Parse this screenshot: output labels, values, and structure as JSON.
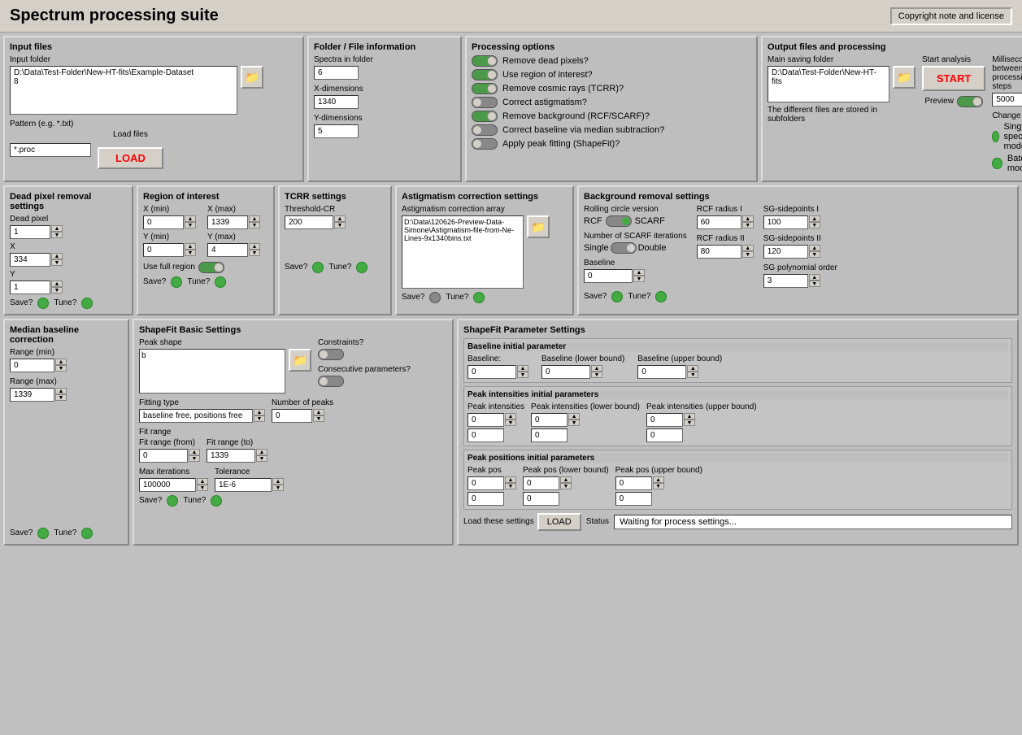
{
  "app": {
    "title": "Spectrum processing suite",
    "copyright_btn": "Copyright note and license"
  },
  "input_files": {
    "section_label": "Input files",
    "input_folder_label": "Input folder",
    "input_folder_value": "D:\\Data\\Test-Folder\\New-HT-fits\\Example-Dataset\n8",
    "pattern_label": "Pattern (e.g. *.txt)",
    "pattern_value": "*.proc",
    "load_files_label": "Load files",
    "load_btn_label": "LOAD"
  },
  "folder_info": {
    "section_label": "Folder / File information",
    "spectra_label": "Spectra in folder",
    "spectra_value": "6",
    "xdim_label": "X-dimensions",
    "xdim_value": "1340",
    "ydim_label": "Y-dimensions",
    "ydim_value": "5"
  },
  "processing_options": {
    "section_label": "Processing options",
    "options": [
      {
        "label": "Remove dead pixels?",
        "state": "on"
      },
      {
        "label": "Use region of interest?",
        "state": "on"
      },
      {
        "label": "Remove cosmic rays (TCRR)?",
        "state": "on"
      },
      {
        "label": "Correct astigmatism?",
        "state": "off"
      },
      {
        "label": "Remove background (RCF/SCARF)?",
        "state": "on"
      },
      {
        "label": "Correct baseline via median subtraction?",
        "state": "off"
      },
      {
        "label": "Apply peak fitting (ShapeFit)?",
        "state": "off"
      }
    ]
  },
  "output_files": {
    "section_label": "Output files and processing",
    "main_saving_folder_label": "Main saving folder",
    "main_saving_folder_value": "D:\\Data\\Test-Folder\\New-HT-fits",
    "subfolders_text": "The different files are stored in subfolders",
    "start_analysis_label": "Start analysis",
    "start_btn_label": "START",
    "preview_label": "Preview",
    "milliseconds_label": "Milliseconds between two processing steps",
    "milliseconds_value": "5000",
    "change_mode_label": "Change mode",
    "single_spectrum_label": "Single spectrum mode",
    "batch_mode_label": "Batch mode"
  },
  "dead_pixel": {
    "section_label": "Dead pixel removal settings",
    "dead_pixel_label": "Dead pixel",
    "dead_pixel_value": "1",
    "x_value": "334",
    "y_value": "1",
    "save_label": "Save?",
    "tune_label": "Tune?"
  },
  "roi": {
    "section_label": "Region of interest",
    "x_min_label": "X (min)",
    "x_min_value": "0",
    "x_max_label": "X (max)",
    "x_max_value": "1339",
    "y_min_label": "Y (min)",
    "y_min_value": "0",
    "y_max_label": "Y (max)",
    "y_max_value": "4",
    "use_full_region_label": "Use full region",
    "save_label": "Save?",
    "tune_label": "Tune?"
  },
  "tcrr": {
    "section_label": "TCRR settings",
    "threshold_label": "Threshold-CR",
    "threshold_value": "200",
    "save_label": "Save?",
    "tune_label": "Tune?"
  },
  "astigmatism": {
    "section_label": "Astigmatism correction settings",
    "array_label": "Astigmatism correction array",
    "array_value": "D:\\Data\\120626-Preview-Data-Simone\\Astigmatism-file-from-Ne-Lines-9x1340bins.txt",
    "save_label": "Save?",
    "tune_label": "Tune?"
  },
  "background": {
    "section_label": "Background removal settings",
    "rolling_circle_label": "Rolling circle version",
    "rcf_label": "RCF",
    "scarf_label": "SCARF",
    "rcf_radius_i_label": "RCF radius I",
    "rcf_radius_i_value": "60",
    "sg_sidepoints_i_label": "SG-sidepoints I",
    "sg_sidepoints_i_value": "100",
    "scarf_iter_label": "Number of SCARF iterations",
    "single_label": "Single",
    "double_label": "Double",
    "rcf_radius_ii_label": "RCF radius II",
    "rcf_radius_ii_value": "80",
    "sg_sidepoints_ii_label": "SG-sidepoints II",
    "sg_sidepoints_ii_value": "120",
    "baseline_label": "Baseline",
    "baseline_value": "0",
    "sg_poly_label": "SG polynomial order",
    "sg_poly_value": "3",
    "save_label": "Save?",
    "tune_label": "Tune?"
  },
  "median_baseline": {
    "section_label": "Median baseline correction",
    "range_min_label": "Range (min)",
    "range_min_value": "0",
    "range_max_label": "Range (max)",
    "range_max_value": "1339",
    "save_label": "Save?",
    "tune_label": "Tune?"
  },
  "shapefit_basic": {
    "section_label": "ShapeFit Basic Settings",
    "peak_shape_label": "Peak shape",
    "peak_shape_value": "b",
    "constraints_label": "Constraints?",
    "consecutive_label": "Consecutive parameters?",
    "fitting_type_label": "Fitting type",
    "fitting_type_value": "baseline free, positions free",
    "num_peaks_label": "Number of peaks",
    "num_peaks_value": "0",
    "fit_range_label": "Fit range",
    "fit_range_from_label": "Fit range (from)",
    "fit_range_from_value": "0",
    "fit_range_to_label": "Fit range (to)",
    "fit_range_to_value": "1339",
    "max_iter_label": "Max iterations",
    "max_iter_value": "100000",
    "tolerance_label": "Tolerance",
    "tolerance_value": "1E-6",
    "save_label": "Save?",
    "tune_label": "Tune?"
  },
  "shapefit_params": {
    "section_label": "ShapeFit Parameter Settings",
    "baseline_init_label": "Baseline initial parameter",
    "baseline_label": "Baseline:",
    "baseline_value": "0",
    "baseline_lower_label": "Baseline (lower bound)",
    "baseline_lower_value": "0",
    "baseline_upper_label": "Baseline (upper bound)",
    "baseline_upper_value": "0",
    "peak_int_label": "Peak intensities initial parameters",
    "peak_int_col_label": "Peak intensities",
    "peak_int_value": "0",
    "peak_int_val2": "0",
    "peak_int_lower_label": "Peak intensities (lower bound)",
    "peak_int_lower_value": "0",
    "peak_int_lower_val2": "0",
    "peak_int_upper_label": "Peak intensities (upper bound)",
    "peak_int_upper_value": "0",
    "peak_int_upper_val2": "0",
    "peak_pos_label": "Peak positions initial parameters",
    "peak_pos_col_label": "Peak pos",
    "peak_pos_value": "0",
    "peak_pos_val2": "0",
    "peak_pos_lower_label": "Peak pos (lower bound)",
    "peak_pos_lower_value": "0",
    "peak_pos_lower_val2": "0",
    "peak_pos_upper_label": "Peak pos (upper bound)",
    "peak_pos_upper_value": "0",
    "peak_pos_upper_val2": "0",
    "load_settings_label": "Load these settings",
    "load_btn_label": "LOAD",
    "status_label": "Status",
    "status_value": "Waiting for process settings..."
  }
}
